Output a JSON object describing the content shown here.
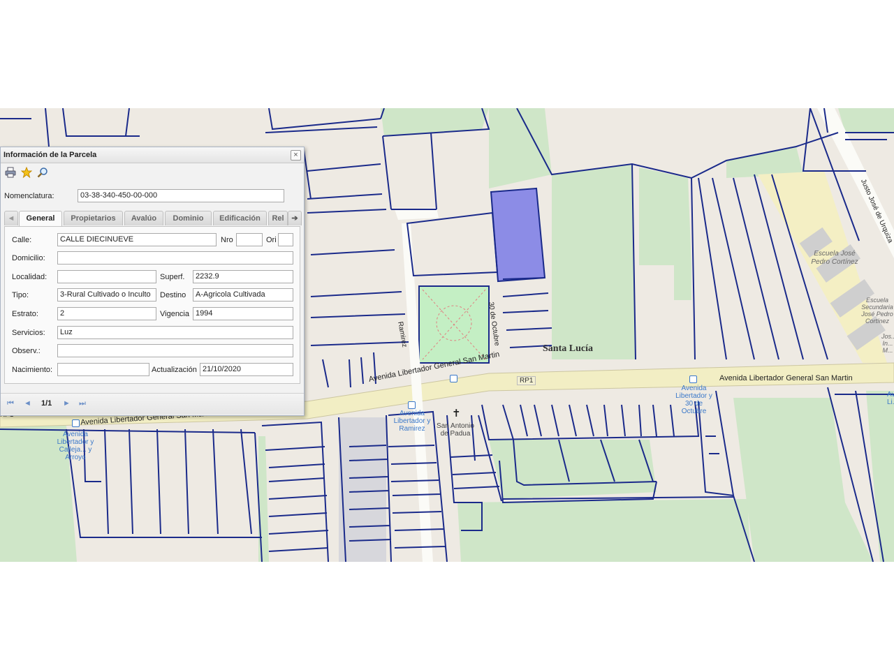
{
  "panel": {
    "title": "Información de la Parcela",
    "close_label": "×",
    "toolbar": {
      "print_icon": "printer-icon",
      "favorite_icon": "star-icon",
      "zoom_icon": "magnifier-icon"
    },
    "nomenclatura_label": "Nomenclatura:",
    "nomenclatura_value": "03-38-340-450-00-000",
    "tabs": {
      "prev_arrow": "◄",
      "next_arrow": "➔",
      "items": [
        "General",
        "Propietarios",
        "Avalúo",
        "Dominio",
        "Edificación",
        "Rel"
      ],
      "active": "General"
    },
    "fields": {
      "calle_label": "Calle:",
      "calle_value": "CALLE DIECINUEVE",
      "nro_label": "Nro",
      "nro_value": "",
      "ori_label": "Ori",
      "ori_value": "",
      "domicilio_label": "Domicilio:",
      "domicilio_value": "",
      "localidad_label": "Localidad:",
      "localidad_value": "",
      "superf_label": "Superf.",
      "superf_value": "2232.9",
      "tipo_label": "Tipo:",
      "tipo_value": "3-Rural Cultivado o Inculto",
      "destino_label": "Destino",
      "destino_value": "A-Agricola Cultivada",
      "estrato_label": "Estrato:",
      "estrato_value": "2",
      "vigencia_label": "Vigencia",
      "vigencia_value": "1994",
      "servicios_label": "Servicios:",
      "servicios_value": "Luz",
      "observ_label": "Observ.:",
      "observ_value": "",
      "nacimiento_label": "Nacimiento:",
      "nacimiento_value": "",
      "actualizacion_label": "Actualización",
      "actualizacion_value": "21/10/2020"
    },
    "pager": {
      "first": "⏮",
      "prev": "◄",
      "page": "1/1",
      "next": "►",
      "last": "⏭"
    }
  },
  "map": {
    "roads": {
      "main_left": "Avenida Libertador General San Martin",
      "main_center": "Avenida Libertador General San Martin",
      "main_right": "Avenida Libertador General San Martin",
      "route_shield": "RP1",
      "route_shield_left": "RP1",
      "ramirez": "Ramirez",
      "oct30": "30 de Octubre",
      "urquiza": "Justo José de Urquiza"
    },
    "place": "Santa Lucía",
    "school": "Escuela José Pedro Cortínez",
    "school2": "Escuela Secundaria José Pedro Cortínez",
    "school3": "Jos... In... M...",
    "pois": {
      "stop1": "Avenida Libertador y Calleja... y Arroyo",
      "stop2": "Avenida Libertador y Ramirez",
      "stop3": "Avenida Libertador y 30 de Octubre",
      "stop4": "Av... Li...",
      "church": "San Antonio de Padua"
    },
    "colors": {
      "parcel_line": "#1a2a8a",
      "selected": "#8c8ce6",
      "green": "#cfe6c8",
      "road": "#f2eec4"
    }
  }
}
